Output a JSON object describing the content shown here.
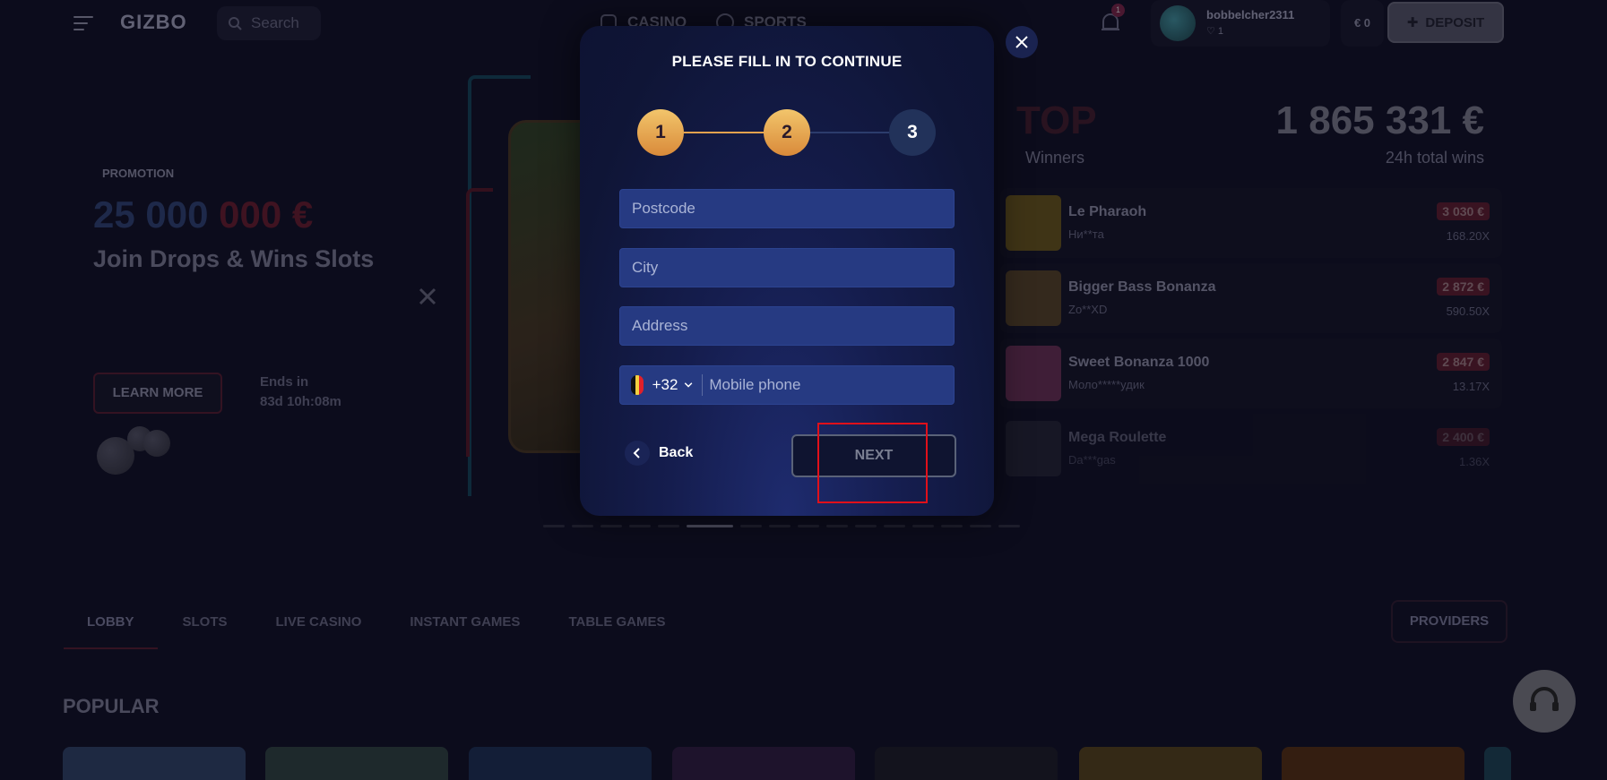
{
  "header": {
    "logo": "GIZBO",
    "search_placeholder": "Search",
    "nav": [
      "CASINO",
      "SPORTS"
    ],
    "notification_count": "1",
    "username": "bobbelcher2311",
    "user_level": "1",
    "balance": "€ 0",
    "deposit_label": "DEPOSIT"
  },
  "hero": {
    "tag": "PROMOTION",
    "amount_part1": "25 000",
    "amount_part2": "000 €",
    "title": "Join Drops & Wins Slots",
    "learn_more": "LEARN MORE",
    "ends_label": "Ends in",
    "ends_value": "83d 10h:08m"
  },
  "top_winners": {
    "title": "TOP",
    "subtitle": "Winners",
    "total": "1 865 331 €",
    "total_label": "24h total wins",
    "items": [
      {
        "game": "Le Pharaoh",
        "user": "Ни**та",
        "amount": "3 030 €",
        "multiplier": "168.20X",
        "color": "#5a4a1a"
      },
      {
        "game": "Bigger Bass Bonanza",
        "user": "Zo**XD",
        "amount": "2 872 €",
        "multiplier": "590.50X",
        "color": "#4a3a24"
      },
      {
        "game": "Sweet Bonanza 1000",
        "user": "Моло*****удик",
        "amount": "2 847 €",
        "multiplier": "13.17X",
        "color": "#5a2a4a"
      },
      {
        "game": "Mega Roulette",
        "user": "Da***gas",
        "amount": "2 400 €",
        "multiplier": "1.36X",
        "color": "#2a2a3a"
      }
    ]
  },
  "tabs": [
    "LOBBY",
    "SLOTS",
    "LIVE CASINO",
    "INSTANT GAMES",
    "TABLE GAMES"
  ],
  "providers_label": "PROVIDERS",
  "popular_label": "POPULAR",
  "modal": {
    "title": "PLEASE FILL IN TO CONTINUE",
    "steps": [
      "1",
      "2",
      "3"
    ],
    "postcode_placeholder": "Postcode",
    "city_placeholder": "City",
    "address_placeholder": "Address",
    "phone_code": "+32",
    "phone_placeholder": "Mobile phone",
    "back_label": "Back",
    "next_label": "NEXT"
  },
  "colors": {
    "step_done": "#e3a24e",
    "step_pending": "#22325a",
    "field_bg": "#263a82",
    "highlight": "#e0101a"
  }
}
